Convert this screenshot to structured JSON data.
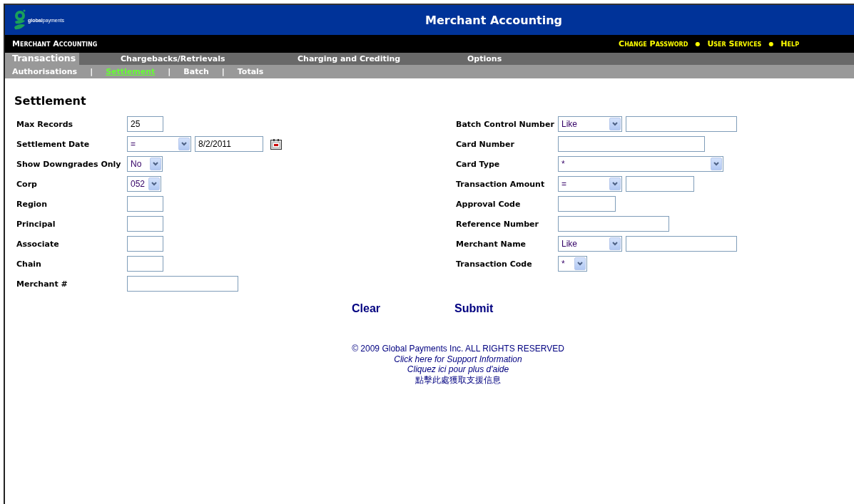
{
  "header": {
    "logo_text": "**global**payments",
    "title": "Merchant Accounting"
  },
  "topbar": {
    "app_name": "Merchant Accounting",
    "links": [
      "Change Password",
      "User Services",
      "Help"
    ],
    "separator": "●"
  },
  "tabs": [
    {
      "label": "Transactions",
      "selected": true
    },
    {
      "label": "Chargebacks/Retrievals",
      "selected": false
    },
    {
      "label": "Charging and Crediting",
      "selected": false
    },
    {
      "label": "Options",
      "selected": false
    }
  ],
  "subtabs": {
    "separator": "|",
    "items": [
      {
        "label": "Authorisations",
        "selected": false
      },
      {
        "label": "Settlement",
        "selected": true
      },
      {
        "label": "Batch",
        "selected": false
      },
      {
        "label": "Totals",
        "selected": false
      }
    ]
  },
  "form": {
    "title": "Settlement",
    "left_fields": [
      {
        "label": "Max Records",
        "controls": [
          {
            "kind": "text",
            "value": "25"
          }
        ]
      },
      {
        "label": "Settlement Date",
        "controls": [
          {
            "kind": "select",
            "value": "="
          },
          {
            "kind": "text",
            "value": "8/2/2011"
          },
          {
            "kind": "calendar"
          }
        ]
      },
      {
        "label": "Show Downgrades Only",
        "controls": [
          {
            "kind": "select",
            "value": "No"
          }
        ]
      },
      {
        "label": "Corp",
        "controls": [
          {
            "kind": "select",
            "value": "052"
          }
        ]
      },
      {
        "label": "Region",
        "controls": [
          {
            "kind": "text"
          }
        ]
      },
      {
        "label": "Principal",
        "controls": [
          {
            "kind": "text"
          }
        ]
      },
      {
        "label": "Associate",
        "controls": [
          {
            "kind": "text"
          }
        ]
      },
      {
        "label": "Chain",
        "controls": [
          {
            "kind": "text"
          }
        ]
      },
      {
        "label": "Merchant #",
        "controls": [
          {
            "kind": "text"
          }
        ]
      }
    ],
    "right_fields": [
      {
        "label": "Batch Control Number",
        "controls": [
          {
            "kind": "select",
            "value": "Like"
          },
          {
            "kind": "text"
          }
        ]
      },
      {
        "label": "Card Number",
        "controls": [
          {
            "kind": "text"
          }
        ]
      },
      {
        "label": "Card Type",
        "controls": [
          {
            "kind": "select",
            "value": "*"
          }
        ]
      },
      {
        "label": "Transaction Amount",
        "controls": [
          {
            "kind": "select",
            "value": "="
          },
          {
            "kind": "text"
          }
        ]
      },
      {
        "label": "Approval Code",
        "controls": [
          {
            "kind": "text"
          }
        ]
      },
      {
        "label": "Reference Number",
        "controls": [
          {
            "kind": "text"
          }
        ]
      },
      {
        "label": "Merchant Name",
        "controls": [
          {
            "kind": "select",
            "value": "Like"
          },
          {
            "kind": "text"
          }
        ]
      },
      {
        "label": "Transaction Code",
        "controls": [
          {
            "kind": "select",
            "value": "*"
          }
        ]
      }
    ],
    "buttons": [
      "Clear",
      "Submit"
    ]
  },
  "footer": {
    "copyright": "© 2009 Global Payments Inc. ALL RIGHTS RESERVED",
    "links": [
      "Click here for Support Information",
      "Cliquez ici pour plus d'aide",
      "點擊此處獲取支援信息"
    ]
  }
}
